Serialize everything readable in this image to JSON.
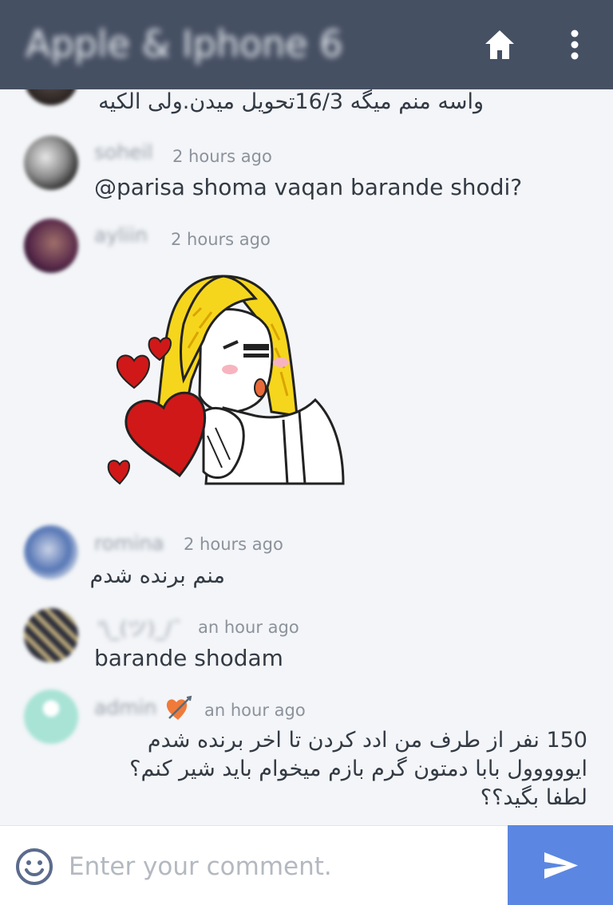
{
  "header": {
    "title": "Apple & Iphone 6",
    "home_icon": "home-icon",
    "more_icon": "more-vertical-icon"
  },
  "comments": [
    {
      "user": "",
      "time": "",
      "lines": [
        "واسه منم میگه 16/3تحویل میدن.ولی الکیه"
      ],
      "rtl": true
    },
    {
      "user": "soheil",
      "time": "2 hours ago",
      "lines": [
        "@parisa shoma vaqan barande shodi?"
      ],
      "rtl": false
    },
    {
      "user": "ayliin",
      "time": "2 hours ago",
      "sticker": "blowing-kiss-sticker",
      "lines": []
    },
    {
      "user": "romina",
      "time": "2 hours ago",
      "lines": [
        "منم برنده شدم"
      ],
      "rtl": true
    },
    {
      "user": "'\\_(ツ)_/¯",
      "time": "an hour ago",
      "lines": [
        "barande shodam"
      ],
      "rtl": false
    },
    {
      "user": "admin",
      "time": "an hour ago",
      "badge_icon": "heart-arrow-badge-icon",
      "lines": [
        "150 نفر از طرف من ادد کردن تا اخر برنده شدم",
        "ایووووول بابا دمتون گرم بازم میخوام باید شیر کنم؟",
        "لطفا بگید؟؟"
      ],
      "rtl": true
    }
  ],
  "input_bar": {
    "emoji_icon": "smiley-icon",
    "placeholder": "Enter your comment.",
    "value": "",
    "send_icon": "send-icon"
  },
  "colors": {
    "header_bg": "#465063",
    "background": "#f3f5f8",
    "send_bg": "#5b87e2",
    "text": "#333a44",
    "muted": "#8c929b"
  }
}
